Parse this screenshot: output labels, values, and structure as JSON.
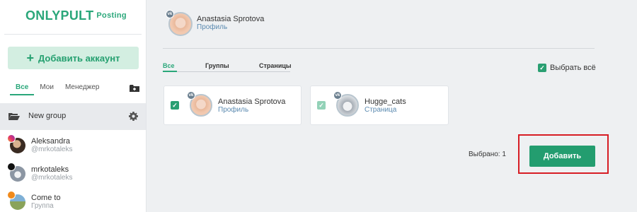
{
  "app": {
    "logo": "ONLYPULT",
    "logo_sub": "Posting"
  },
  "sidebar": {
    "add_account": "Добавить аккаунт",
    "filter_tabs": [
      "Все",
      "Мои",
      "Менеджер"
    ],
    "active_filter": "Все",
    "group": {
      "name": "New group"
    },
    "accounts": [
      {
        "name": "Aleksandra",
        "handle": "@mrkotaleks",
        "network": "instagram"
      },
      {
        "name": "mrkotaleks",
        "handle": "@mrkotaleks",
        "network": "tiktok"
      },
      {
        "name": "Come to",
        "handle": "Группа",
        "network": "odnoklassniki"
      }
    ]
  },
  "main": {
    "current_profile": {
      "name": "Anastasia Sprotova",
      "type": "Профиль",
      "network": "vk"
    },
    "tabs": [
      "Все",
      "Группы",
      "Страницы"
    ],
    "active_tab": "Все",
    "select_all_label": "Выбрать всё",
    "select_all_checked": true,
    "cards": [
      {
        "name": "Anastasia Sprotova",
        "type": "Профиль",
        "checked": true
      },
      {
        "name": "Hugge_cats",
        "type": "Страница",
        "checked": true
      }
    ],
    "selected_label": "Выбрано: 1",
    "add_button": "Добавить"
  },
  "colors": {
    "accent": "#2aa77a",
    "button": "#239d6f",
    "highlight": "#d71d24"
  }
}
